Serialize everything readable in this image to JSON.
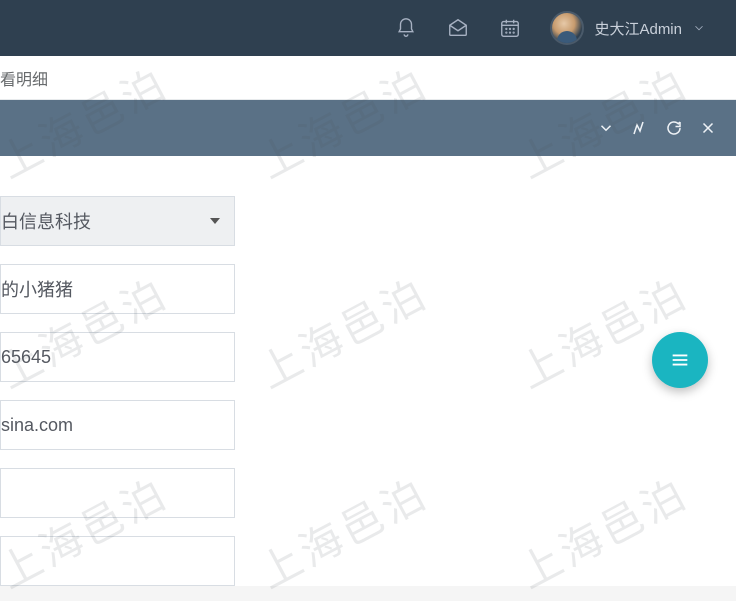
{
  "header": {
    "user_name": "史大江Admin"
  },
  "breadcrumb": {
    "current": "看明细"
  },
  "form": {
    "fields": [
      {
        "value": "白信息科技",
        "type": "select"
      },
      {
        "value": "的小猪猪",
        "type": "text"
      },
      {
        "value": "65645",
        "type": "text"
      },
      {
        "value": "sina.com",
        "type": "text"
      },
      {
        "value": "",
        "type": "text"
      },
      {
        "value": "",
        "type": "text"
      }
    ]
  },
  "watermark_text": "上海邑泊"
}
